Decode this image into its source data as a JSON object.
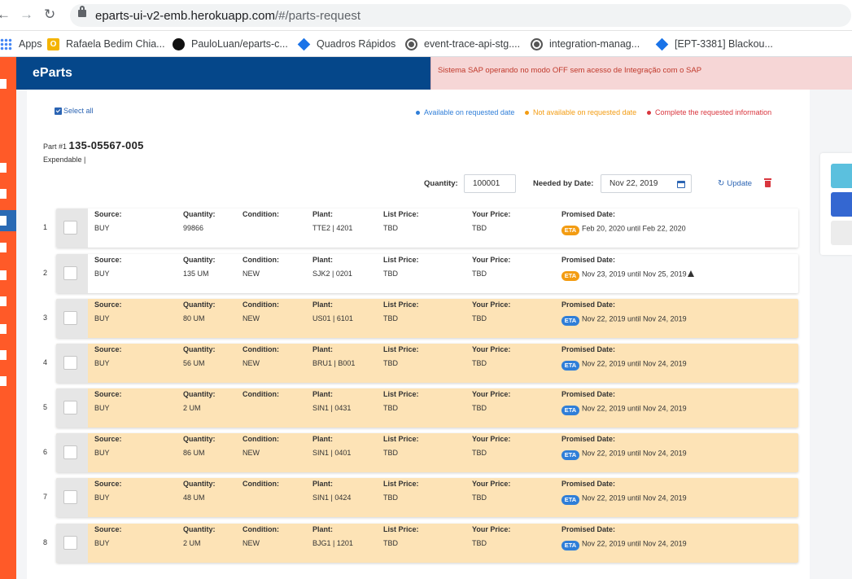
{
  "browser": {
    "url_host": "eparts-ui-v2-emb.herokuapp.com",
    "url_path": "/#/parts-request",
    "bookmarks": [
      {
        "label": "Apps",
        "icon": "apps-grid-icon"
      },
      {
        "label": "Rafaela Bedim Chia...",
        "icon": "orange-o-icon"
      },
      {
        "label": "PauloLuan/eparts-c...",
        "icon": "github-icon"
      },
      {
        "label": "Quadros Rápidos",
        "icon": "diamond-icon"
      },
      {
        "label": "event-trace-api-stg....",
        "icon": "globe-icon"
      },
      {
        "label": "integration-manag...",
        "icon": "globe-icon"
      },
      {
        "label": "[EPT-3381] Blackou...",
        "icon": "diamond-icon"
      }
    ]
  },
  "app": {
    "brand": "eParts",
    "sap_alert": "Sistema SAP operando no modo OFF sem acesso de Integração com o SAP",
    "colors": {
      "header": "#05478a",
      "sidebar": "#ff5a28",
      "alert_bg": "#f6d6d6",
      "alert_text": "#c0392b",
      "row_highlight": "#fde3b6"
    }
  },
  "toolbar": {
    "select_all": "Select all",
    "legend": [
      {
        "label": "Available on requested date",
        "color": "#2f7ed8"
      },
      {
        "label": "Not available on requested date",
        "color": "#f39c12"
      },
      {
        "label": "Complete the requested information",
        "color": "#d9363e"
      }
    ]
  },
  "part": {
    "prefix": "Part #1",
    "number": "135-05567-005",
    "type": "Expendable |",
    "quantity_label": "Quantity:",
    "quantity_value": "100001",
    "needed_label": "Needed by Date:",
    "needed_date": "Nov 22, 2019",
    "update_label": "Update"
  },
  "columns": {
    "source": "Source:",
    "quantity": "Quantity:",
    "condition": "Condition:",
    "plant": "Plant:",
    "list_price": "List Price:",
    "your_price": "Your Price:",
    "promised": "Promised Date:"
  },
  "rows": [
    {
      "n": "1",
      "source": "BUY",
      "quantity": "99866",
      "condition": "",
      "plant": "TTE2 | 4201",
      "list_price": "TBD",
      "your_price": "TBD",
      "eta": "ETA",
      "eta_color": "orange",
      "promised": "Feb 20, 2020 until Feb 22, 2020",
      "warning": false,
      "highlight": false
    },
    {
      "n": "2",
      "source": "BUY",
      "quantity": "135 UM",
      "condition": "NEW",
      "plant": "SJK2 | 0201",
      "list_price": "TBD",
      "your_price": "TBD",
      "eta": "ETA",
      "eta_color": "orange",
      "promised": "Nov 23, 2019 until Nov 25, 2019",
      "warning": true,
      "highlight": false
    },
    {
      "n": "3",
      "source": "BUY",
      "quantity": "80 UM",
      "condition": "NEW",
      "plant": "US01 | 6101",
      "list_price": "TBD",
      "your_price": "TBD",
      "eta": "ETA",
      "eta_color": "blue",
      "promised": "Nov 22, 2019 until Nov 24, 2019",
      "warning": false,
      "highlight": true
    },
    {
      "n": "4",
      "source": "BUY",
      "quantity": "56 UM",
      "condition": "NEW",
      "plant": "BRU1 | B001",
      "list_price": "TBD",
      "your_price": "TBD",
      "eta": "ETA",
      "eta_color": "blue",
      "promised": "Nov 22, 2019 until Nov 24, 2019",
      "warning": false,
      "highlight": true
    },
    {
      "n": "5",
      "source": "BUY",
      "quantity": "2 UM",
      "condition": "",
      "plant": "SIN1 | 0431",
      "list_price": "TBD",
      "your_price": "TBD",
      "eta": "ETA",
      "eta_color": "blue",
      "promised": "Nov 22, 2019 until Nov 24, 2019",
      "warning": false,
      "highlight": true
    },
    {
      "n": "6",
      "source": "BUY",
      "quantity": "86 UM",
      "condition": "NEW",
      "plant": "SIN1 | 0401",
      "list_price": "TBD",
      "your_price": "TBD",
      "eta": "ETA",
      "eta_color": "blue",
      "promised": "Nov 22, 2019 until Nov 24, 2019",
      "warning": false,
      "highlight": true
    },
    {
      "n": "7",
      "source": "BUY",
      "quantity": "48 UM",
      "condition": "",
      "plant": "SIN1 | 0424",
      "list_price": "TBD",
      "your_price": "TBD",
      "eta": "ETA",
      "eta_color": "blue",
      "promised": "Nov 22, 2019 until Nov 24, 2019",
      "warning": false,
      "highlight": true
    },
    {
      "n": "8",
      "source": "BUY",
      "quantity": "2 UM",
      "condition": "NEW",
      "plant": "BJG1 | 1201",
      "list_price": "TBD",
      "your_price": "TBD",
      "eta": "ETA",
      "eta_color": "blue",
      "promised": "Nov 22, 2019 until Nov 24, 2019",
      "warning": false,
      "highlight": true
    }
  ]
}
